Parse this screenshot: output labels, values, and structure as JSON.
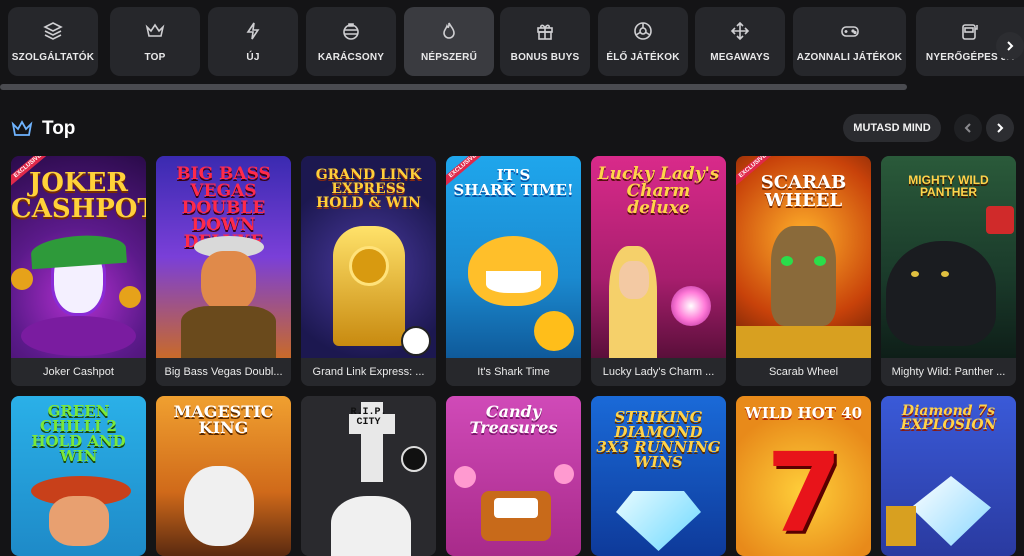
{
  "categories": [
    {
      "label": "SZOLGÁLTATÓK",
      "icon": "layers-icon"
    },
    {
      "label": "TOP",
      "icon": "crown-icon"
    },
    {
      "label": "ÚJ",
      "icon": "lightning-icon"
    },
    {
      "label": "KARÁCSONY",
      "icon": "ornament-icon"
    },
    {
      "label": "NÉPSZERŰ",
      "icon": "flame-icon",
      "active": true
    },
    {
      "label": "BONUS BUYS",
      "icon": "gift-icon"
    },
    {
      "label": "ÉLŐ JÁTÉKOK",
      "icon": "chip-icon"
    },
    {
      "label": "MEGAWAYS",
      "icon": "arrows-icon"
    },
    {
      "label": "AZONNALI JÁTÉKOK",
      "icon": "gamepad-icon"
    },
    {
      "label": "NYERŐGÉPES JÁ",
      "icon": "slot-machine-icon"
    }
  ],
  "section": {
    "title": "Top",
    "show_all": "MUTASD MIND"
  },
  "games_row1": [
    {
      "title": "Joker Cashpot",
      "logo": "JOKER\nCASHPOT",
      "exclusive": "EXCLUSIVE"
    },
    {
      "title": "Big Bass Vegas Doubl...",
      "logo": "BIG BASS\nVEGAS\nDOUBLE DOWN\nDELUXE"
    },
    {
      "title": "Grand Link Express: ...",
      "logo": "GRAND LINK\nEXPRESS\nHOLD & WIN"
    },
    {
      "title": "It's Shark Time",
      "logo": "IT'S\nSHARK TIME!",
      "exclusive": "EXCLUSIVE"
    },
    {
      "title": "Lucky Lady's Charm ...",
      "logo": "Lucky Lady's\nCharm\ndeluxe"
    },
    {
      "title": "Scarab Wheel",
      "logo": "SCARAB\nWHEEL",
      "exclusive": "EXCLUSIVE"
    },
    {
      "title": "Mighty Wild: Panther ...",
      "logo": "MIGHTY WILD\nPANTHER"
    }
  ],
  "games_row2": [
    {
      "logo": "GREEN\nCHILLI 2\nHOLD AND WIN"
    },
    {
      "logo": "MAGESTIC\nKING"
    },
    {
      "logo": "R.I.P.\nCITY"
    },
    {
      "logo": "Candy\nTreasures"
    },
    {
      "logo": "STRIKING\nDIAMOND\n3X3 RUNNING WINS"
    },
    {
      "logo": "WILD HOT 40"
    },
    {
      "logo": "Diamond 7s\nEXPLOSION"
    }
  ],
  "colors": {
    "background": "#141416",
    "card": "#26272b",
    "active": "#3a3b40",
    "accent_crown": "#6fb4ff"
  }
}
